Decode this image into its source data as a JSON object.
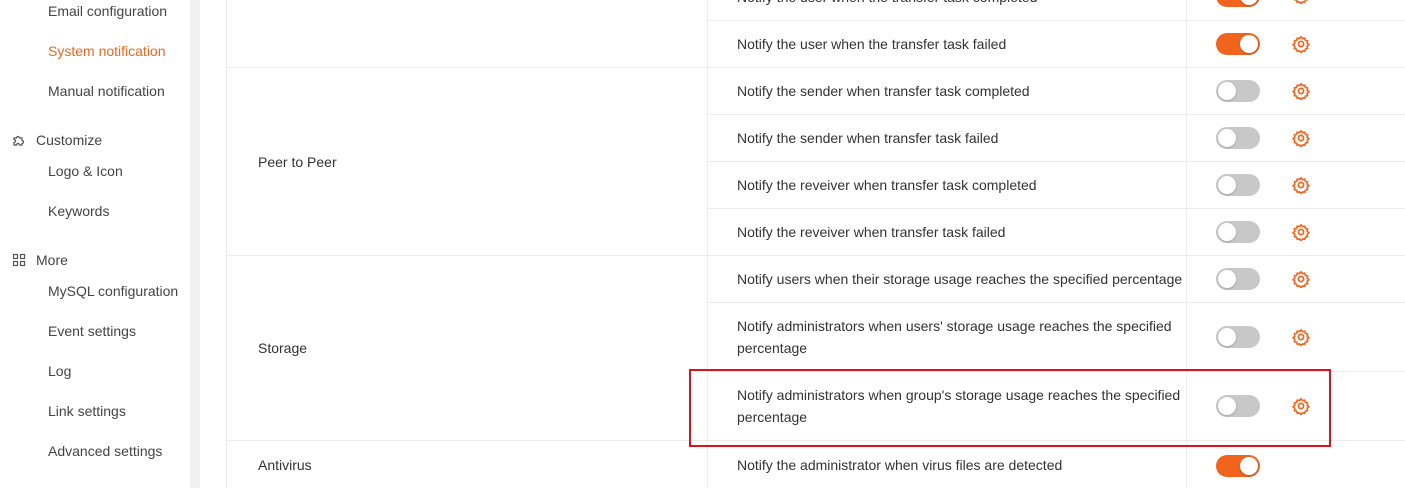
{
  "sidebar": {
    "items": [
      {
        "label": "Email configuration",
        "type": "sub",
        "active": false
      },
      {
        "label": "System notification",
        "type": "sub",
        "active": true
      },
      {
        "label": "Manual notification",
        "type": "sub",
        "active": false
      },
      {
        "label": "Customize",
        "type": "group",
        "icon": "puzzle-icon"
      },
      {
        "label": "Logo & Icon",
        "type": "sub",
        "active": false
      },
      {
        "label": "Keywords",
        "type": "sub",
        "active": false
      },
      {
        "label": "More",
        "type": "group",
        "icon": "grid-icon"
      },
      {
        "label": "MySQL configuration",
        "type": "sub",
        "active": false
      },
      {
        "label": "Event settings",
        "type": "sub",
        "active": false
      },
      {
        "label": "Log",
        "type": "sub",
        "active": false
      },
      {
        "label": "Link settings",
        "type": "sub",
        "active": false
      },
      {
        "label": "Advanced settings",
        "type": "sub",
        "active": false
      }
    ]
  },
  "table": {
    "categories": [
      "Peer to Peer",
      "Storage",
      "Antivirus"
    ],
    "rows": [
      {
        "text": "Notify the user when the transfer task completed",
        "enabled": true
      },
      {
        "text": "Notify the user when the transfer task failed",
        "enabled": true
      },
      {
        "text": "Notify the sender when transfer task completed",
        "enabled": false
      },
      {
        "text": "Notify the sender when transfer task failed",
        "enabled": false
      },
      {
        "text": "Notify the reveiver when transfer task completed",
        "enabled": false
      },
      {
        "text": "Notify the reveiver when transfer task failed",
        "enabled": false
      },
      {
        "text": "Notify users when their storage usage reaches the specified percentage",
        "enabled": false
      },
      {
        "text": "Notify administrators when users' storage usage reaches the specified percentage",
        "enabled": false
      },
      {
        "text": "Notify administrators when group's storage usage reaches the specified percentage",
        "enabled": false
      },
      {
        "text": "Notify the administrator when virus files are detected",
        "enabled": true
      }
    ]
  },
  "colors": {
    "accent": "#f0641e",
    "highlight_box": "#d9141e",
    "toggle_off": "#c8c8c8"
  }
}
